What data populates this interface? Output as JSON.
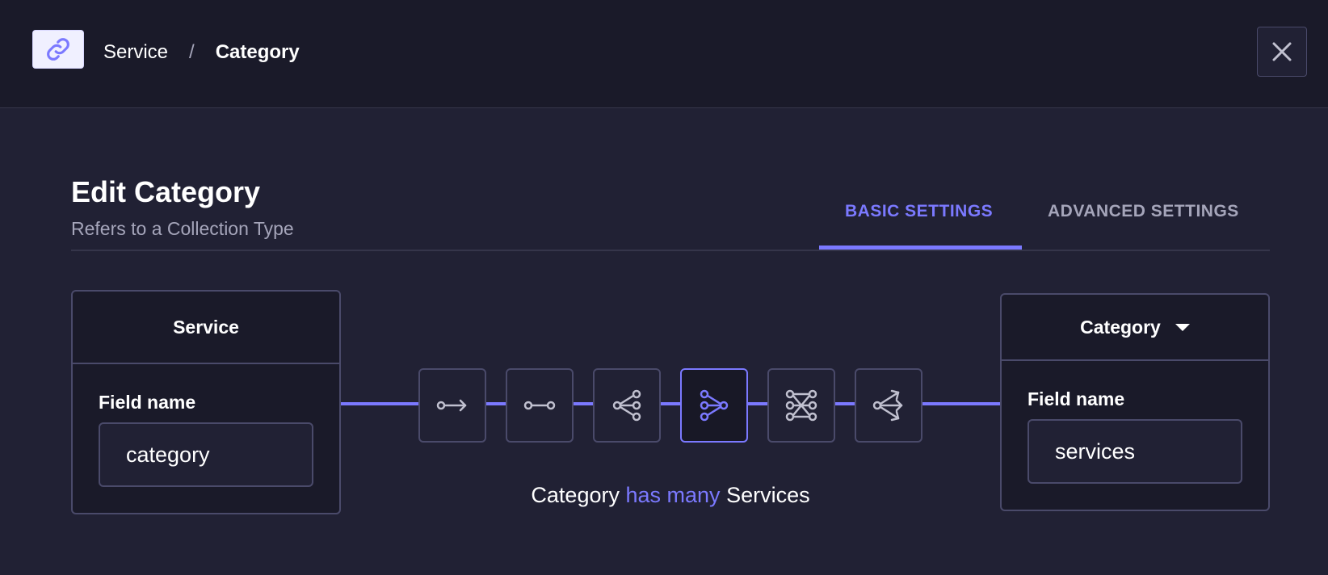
{
  "header": {
    "icon": "link-icon",
    "breadcrumb": [
      "Service",
      "Category"
    ],
    "breadcrumb_separator": "/",
    "close_icon": "close-icon"
  },
  "main": {
    "title": "Edit Category",
    "subtitle": "Refers to a Collection Type",
    "tabs": [
      {
        "label": "BASIC SETTINGS",
        "active": true
      },
      {
        "label": "ADVANCED SETTINGS",
        "active": false
      }
    ]
  },
  "left_card": {
    "title": "Service",
    "field_label": "Field name",
    "field_value": "category"
  },
  "right_card": {
    "title": "Category",
    "field_label": "Field name",
    "field_value": "services",
    "dropdown_icon": "caret-down-icon"
  },
  "relations": [
    {
      "icon": "one-way-arrow-icon",
      "active": false
    },
    {
      "icon": "one-to-one-icon",
      "active": false
    },
    {
      "icon": "many-to-one-icon",
      "active": false
    },
    {
      "icon": "one-to-many-icon",
      "active": true
    },
    {
      "icon": "many-to-many-icon",
      "active": false
    },
    {
      "icon": "many-way-arrow-icon",
      "active": false
    }
  ],
  "relation_description": {
    "subject": "Category",
    "verb": "has many",
    "object": "Services"
  },
  "colors": {
    "accent": "#7b79ff",
    "background": "#212134",
    "panel": "#1a1a29",
    "border": "#4a4a6a",
    "muted_text": "#a5a5ba"
  }
}
